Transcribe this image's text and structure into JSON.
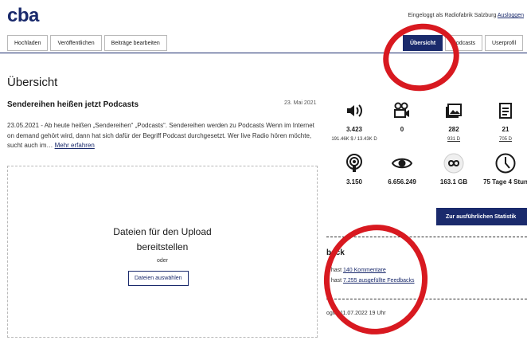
{
  "header": {
    "logo": "cba",
    "login_prefix": "Eingeloggt als Radiofabrik Salzburg",
    "logout_label": "Ausloggen"
  },
  "nav": {
    "tabs_left": [
      "Hochladen",
      "Veröffentlichen",
      "Beiträge bearbeiten"
    ],
    "tabs_right": [
      "Übersicht",
      "Podcasts",
      "Userprofil"
    ],
    "active_tab": "Übersicht"
  },
  "page": {
    "title": "Übersicht"
  },
  "news": {
    "title": "Sendereihen heißen jetzt Podcasts",
    "date": "23. Mai 2021",
    "body": "23.05.2021 - Ab heute heißen „Sendereihen“ „Podcasts“.   Sendereihen werden zu Podcasts Wenn im Internet on demand gehört wird, dann hat sich dafür der Begriff Podcast durchgesetzt. Wer live Radio hören möchte, sucht auch im…",
    "more_link": "Mehr erfahren"
  },
  "upload": {
    "title_line1": "Dateien für den Upload",
    "title_line2": "bereitstellen",
    "or": "oder",
    "button": "Dateien auswählen"
  },
  "stats": [
    {
      "icon": "audio-icon",
      "value": "3.423",
      "sub": "191.46K $ / 13.43K D"
    },
    {
      "icon": "video-icon",
      "value": "0",
      "sub": ""
    },
    {
      "icon": "image-icon",
      "value": "282",
      "sub": "931 D"
    },
    {
      "icon": "document-icon",
      "value": "21",
      "sub": "705 D"
    },
    {
      "icon": "podcast-icon",
      "value": "3.150",
      "sub": ""
    },
    {
      "icon": "eye-icon",
      "value": "6.656.249",
      "sub": ""
    },
    {
      "icon": "infinity-icon",
      "value": "163.1 GB",
      "sub": ""
    },
    {
      "icon": "clock-icon",
      "value": "75 Tage 4 Stun",
      "sub": ""
    }
  ],
  "stats_button": "Zur ausführlichen Statistik",
  "feedback": {
    "title": "back",
    "line1_prefix": "u hast ",
    "line1_link": "140 Kommentare",
    "line2_prefix": "u hast ",
    "line2_link": "7.255 ausgefüllte Feedbacks",
    "last_login": "ogin: 11.07.2022 19 Uhr"
  },
  "colors": {
    "brand": "#1a2a6c",
    "annotation": "#d81920",
    "border": "#b9b9b9"
  }
}
